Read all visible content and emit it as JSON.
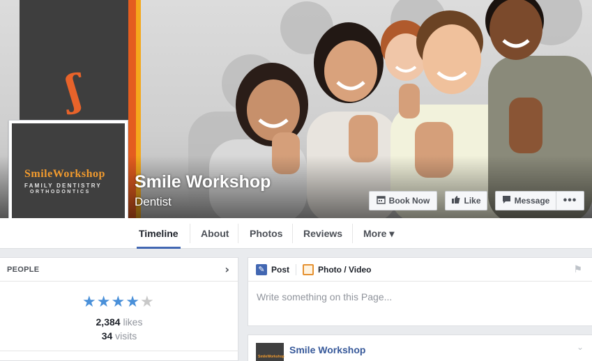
{
  "page": {
    "name": "Smile Workshop",
    "category": "Dentist"
  },
  "cover_logo": {
    "main": "SmileWorkshop",
    "line1": "FAMILY DENTISTRY",
    "line2": "ORTHODONTICS"
  },
  "actions": {
    "book_now": "Book Now",
    "like": "Like",
    "message": "Message",
    "more": "•••"
  },
  "tabs": [
    {
      "label": "Timeline",
      "selected": true
    },
    {
      "label": "About"
    },
    {
      "label": "Photos"
    },
    {
      "label": "Reviews"
    },
    {
      "label": "More ▾"
    }
  ],
  "people": {
    "title": "PEOPLE",
    "rating": 4,
    "rating_max": 5,
    "likes_count": "2,384",
    "likes_label": "likes",
    "visits_count": "34",
    "visits_label": "visits"
  },
  "composer": {
    "post_tab": "Post",
    "photo_tab": "Photo / Video",
    "placeholder": "Write something on this Page..."
  },
  "post": {
    "author": "Smile Workshop"
  },
  "colors": {
    "accent": "#4267b2",
    "link": "#365899",
    "star_on": "#4a90d9",
    "star_off": "#c8c8c8",
    "brand_orange": "#e45d1f"
  }
}
